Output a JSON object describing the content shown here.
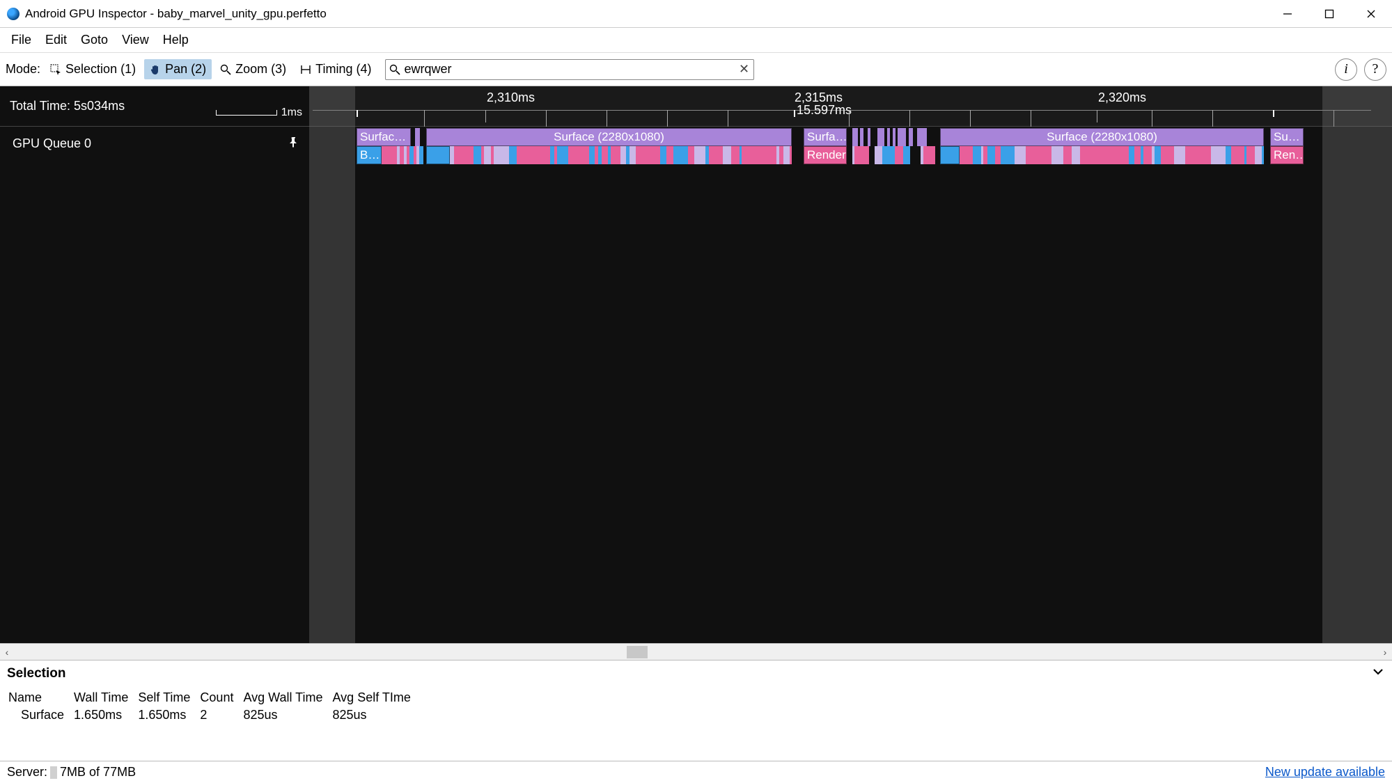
{
  "window": {
    "title": "Android GPU Inspector - baby_marvel_unity_gpu.perfetto"
  },
  "menu": {
    "file": "File",
    "edit": "Edit",
    "goto": "Goto",
    "view": "View",
    "help": "Help"
  },
  "toolbar": {
    "mode_label": "Mode:",
    "selection": "Selection (1)",
    "pan": "Pan (2)",
    "zoom": "Zoom (3)",
    "timing": "Timing (4)",
    "search_value": "ewrqwer"
  },
  "timeline": {
    "total_time": "Total Time: 5s034ms",
    "scale_label": "1ms",
    "ruler_labels": {
      "a": "2,310ms",
      "b": "2,315ms",
      "c": "2,320ms"
    },
    "frame_label": "15.597ms",
    "track_name": "GPU Queue 0",
    "blocks": {
      "surf_trunc": "Surfac…",
      "surf_full": "Surface (2280x1080)",
      "surf_short": "Surfa…",
      "surf_tiny": "Su…",
      "b": "B…",
      "render": "Render",
      "ren": "Ren…"
    }
  },
  "selection": {
    "title": "Selection",
    "headers": {
      "name": "Name",
      "wall": "Wall Time",
      "self": "Self Time",
      "count": "Count",
      "avgw": "Avg Wall Time",
      "avgs": "Avg Self TIme"
    },
    "row": {
      "name": "Surface",
      "wall": "1.650ms",
      "self": "1.650ms",
      "count": "2",
      "avgw": "825us",
      "avgs": "825us"
    }
  },
  "status": {
    "server_label": "Server:",
    "server_value": "7MB of 77MB",
    "update": "New update available"
  }
}
